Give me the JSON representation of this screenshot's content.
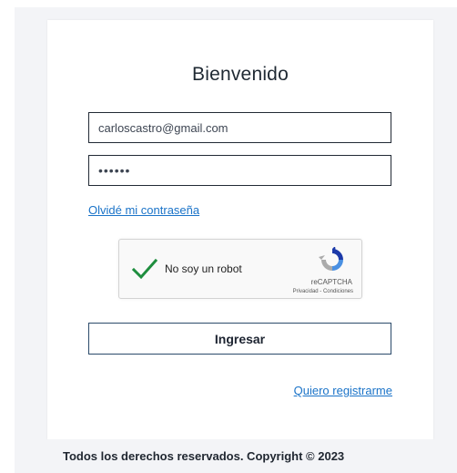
{
  "login": {
    "title": "Bienvenido",
    "email_value": "carloscastro@gmail.com",
    "password_value": "••••••",
    "forgot_link": "Olvidé mi contraseña",
    "submit_label": "Ingresar",
    "register_link": "Quiero registrarme"
  },
  "captcha": {
    "label": "No soy un robot",
    "brand": "reCAPTCHA",
    "terms": "Privacidad - Condiciones",
    "checked": true,
    "check_color": "#1e8e3e",
    "icon": "recaptcha-logo-icon"
  },
  "footer": {
    "text": "Todos los derechos reservados. Copyright © 2023"
  },
  "colors": {
    "link": "#1a73c8",
    "background": "#f3f4f7",
    "border": "#222a35"
  }
}
